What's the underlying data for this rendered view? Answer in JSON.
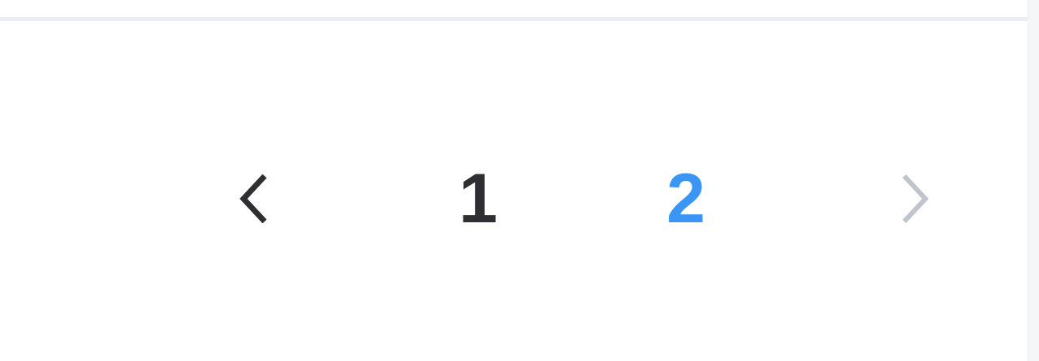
{
  "pagination": {
    "pages": [
      {
        "label": "1",
        "active": false
      },
      {
        "label": "2",
        "active": true
      }
    ],
    "current_page": 2,
    "prev": {
      "icon": "chevron-left-icon",
      "enabled": true
    },
    "next": {
      "icon": "chevron-right-icon",
      "enabled": false
    }
  },
  "colors": {
    "text": "#2f2f33",
    "active": "#3a95f5",
    "disabled": "#c0c4cc",
    "divider": "#eceef5"
  }
}
